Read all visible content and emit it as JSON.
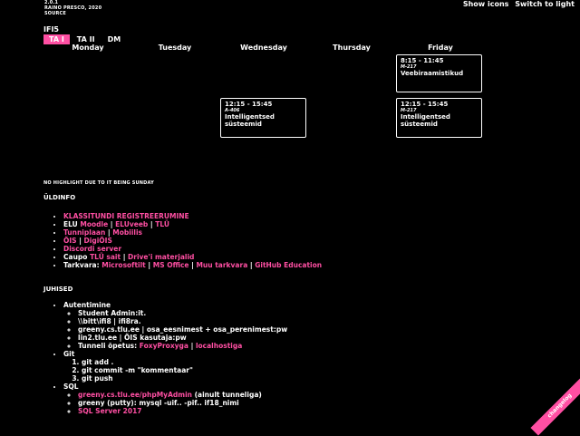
{
  "meta": {
    "version": "2.0.1",
    "author": "RAINO PRESCO, 2020",
    "source": "SOURCE"
  },
  "topbar": {
    "show_icons": "Show icons",
    "switch_theme": "Switch to light"
  },
  "group": "IFI5",
  "tabs": [
    "TA I",
    "TA II",
    "DM"
  ],
  "days": [
    "Monday",
    "Tuesday",
    "Wednesday",
    "Thursday",
    "Friday"
  ],
  "slots": [
    {
      "time": "8:15 - 11:45",
      "room": "M-217",
      "title": "Veebiraamistikud"
    },
    {
      "time": "12:15 - 15:45",
      "room": "A-406",
      "title": "Intelligentsed süsteemid"
    },
    {
      "time": "12:15 - 15:45",
      "room": "M-217",
      "title": "Intelligentsed süsteemid"
    }
  ],
  "highlight_note": "NO HIGHLIGHT DUE TO IT BEING SUNDAY",
  "uldinfo": {
    "title": "ÜLDINFO",
    "items": {
      "klassitundi": "KLASSITUNDI REGISTREERUMINE",
      "elu_prefix": "ELU",
      "elu_links": [
        "Moodle",
        "ELUveeb",
        "TLÜ"
      ],
      "tunniplaan": "Tunniplaan",
      "mobiilis": "Mobiilis",
      "ois": "ÕIS",
      "digiois": "DigiÕIS",
      "discord": "Discordi server",
      "caupo_prefix": "Caupo",
      "caupo_links": [
        "TLÜ sait",
        "Drive'i materjalid"
      ],
      "tarkvara_prefix": "Tarkvara:",
      "tarkvara_links": [
        "Microsoftilt",
        "MS Office",
        "Muu tarkvara",
        "GitHub Education"
      ]
    }
  },
  "juhised": {
    "title": "JUHISED",
    "autentimine": "Autentimine",
    "auth_items": [
      "Student Admin:it.",
      "\\\\bitt\\ifi8 | ifi8ra.",
      "greeny.cs.tlu.ee | osa_eesnimest + osa_perenimest:pw",
      "lin2.tlu.ee | ÕIS kasutaja:pw"
    ],
    "tunnel_prefix": "Tunneli õpetus:",
    "tunnel_links": [
      "FoxyProxyga",
      "localhostiga"
    ],
    "git": "Git",
    "git_items": [
      "git add .",
      "git commit -m \"kommentaar\"",
      "git push"
    ],
    "sql": "SQL",
    "sql_link1": "greeny.cs.tlu.ee/phpMyAdmin",
    "sql_link1_suffix": "(ainult tunneliga)",
    "sql_item2": "greeny (putty): mysql -uif.. -pif.. if18_nimi",
    "sql_link3": "SQL Server 2017"
  },
  "changelog": "changelog"
}
